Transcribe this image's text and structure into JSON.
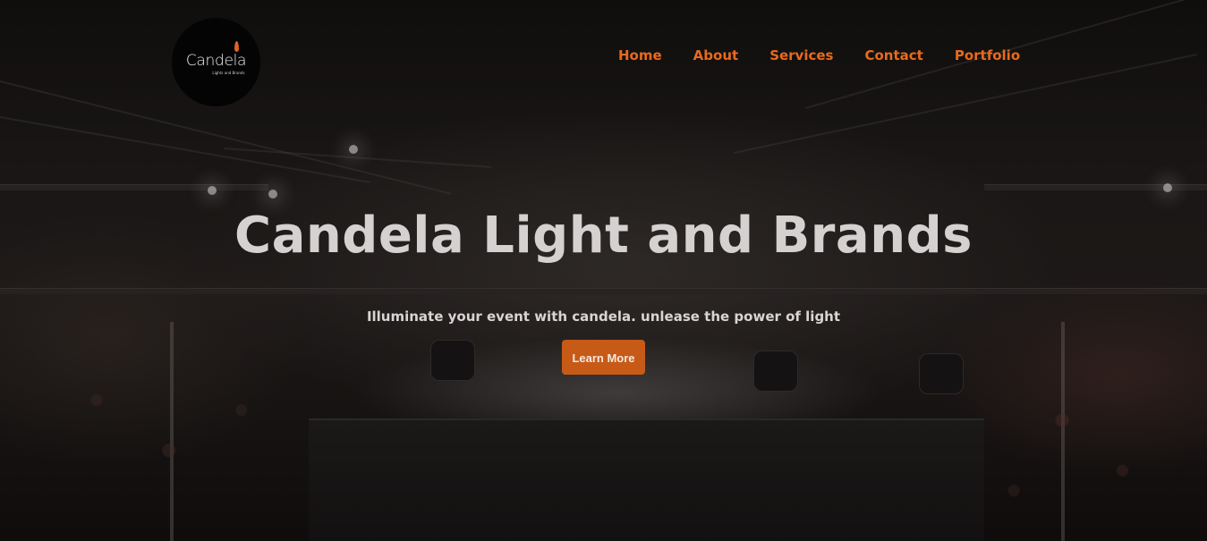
{
  "header": {
    "logo": {
      "name": "Candela",
      "tagline": "Lights and Brands"
    },
    "nav": [
      {
        "label": "Home"
      },
      {
        "label": "About"
      },
      {
        "label": "Services"
      },
      {
        "label": "Contact"
      },
      {
        "label": "Portfolio"
      }
    ]
  },
  "hero": {
    "title": "Candela Light and Brands",
    "subtitle": "Illuminate your event with candela. unlease the power of light",
    "cta_label": "Learn More"
  },
  "colors": {
    "accent": "#e86a1c",
    "button": "#c85a17",
    "background": "#141110",
    "headline": "#d4d1d0"
  }
}
